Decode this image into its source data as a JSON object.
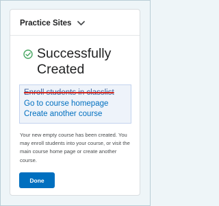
{
  "header": {
    "site_name": "Practice Sites"
  },
  "status": {
    "title_line1": "Successfully",
    "title_line2": "Created"
  },
  "links": {
    "enroll": "Enroll students in classlist",
    "homepage": "Go to course homepage",
    "create_another": "Create another course"
  },
  "description": "Your new empty course has been created. You may enroll students into your course, or visit the main course home page or create another course.",
  "actions": {
    "done_label": "Done"
  },
  "colors": {
    "accent": "#006fbf",
    "success": "#46a661",
    "strike": "#d3271d"
  }
}
